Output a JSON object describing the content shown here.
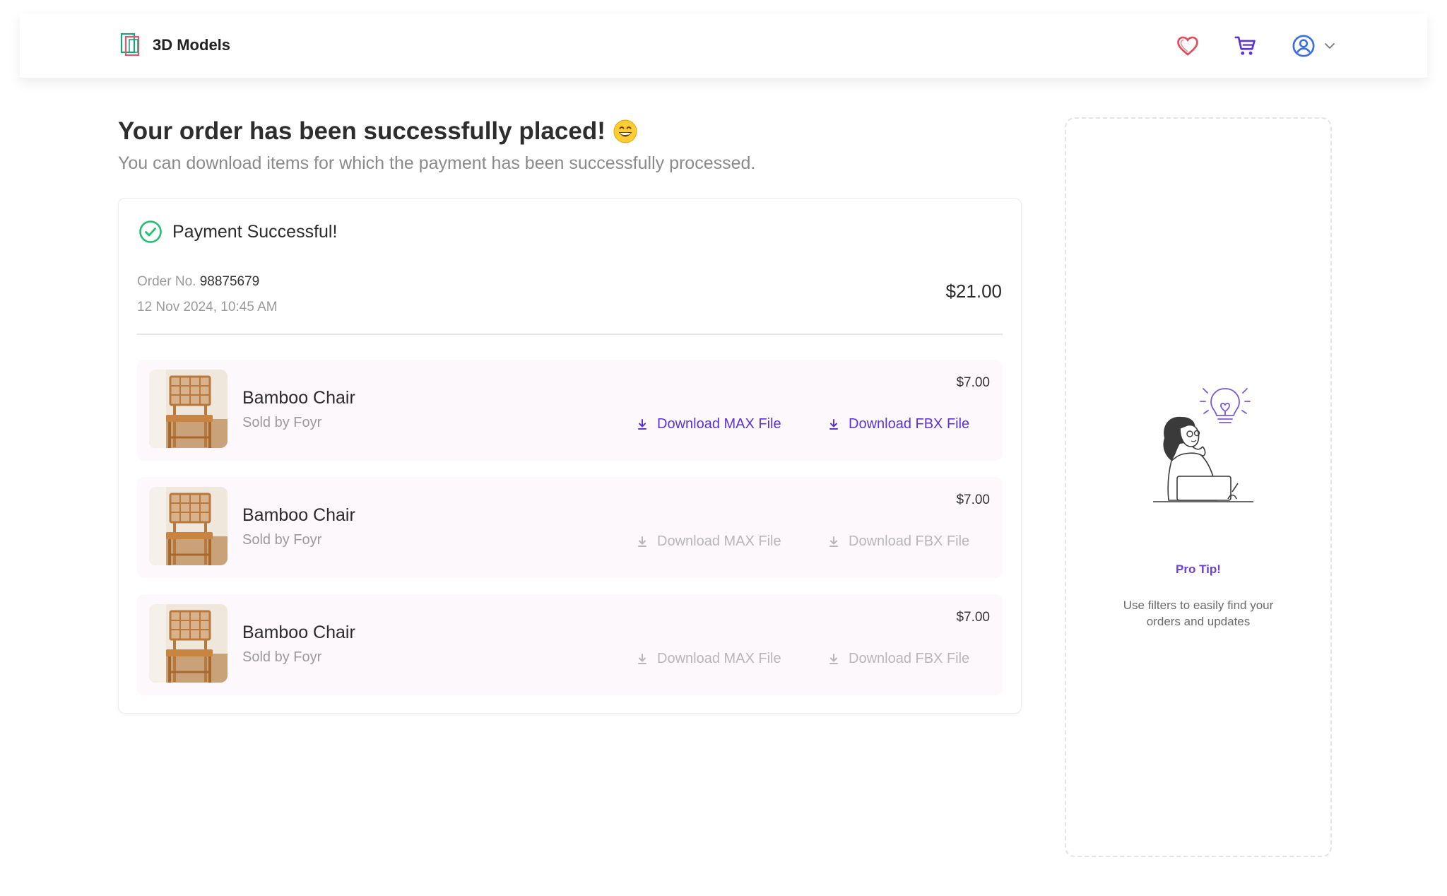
{
  "header": {
    "brand_name": "3D Models",
    "icons": [
      "logo-icon",
      "heart-icon",
      "cart-icon",
      "user-icon",
      "chevron-down-icon"
    ]
  },
  "page": {
    "title": "Your order has been successfully placed!",
    "subtitle": "You can download items for which the payment has been successfully processed."
  },
  "order": {
    "status": "Payment Successful!",
    "order_no_label": "Order No.",
    "order_no": "98875679",
    "date": "12 Nov 2024, 10:45 AM",
    "total": "$21.00",
    "items": [
      {
        "name": "Bamboo Chair",
        "seller": "Sold by Foyr",
        "price": "$7.00",
        "download_max": "Download MAX File",
        "download_fbx": "Download FBX File",
        "downloads_enabled": true
      },
      {
        "name": "Bamboo Chair",
        "seller": "Sold by Foyr",
        "price": "$7.00",
        "download_max": "Download MAX File",
        "download_fbx": "Download FBX File",
        "downloads_enabled": false
      },
      {
        "name": "Bamboo Chair",
        "seller": "Sold by Foyr",
        "price": "$7.00",
        "download_max": "Download MAX File",
        "download_fbx": "Download FBX File",
        "downloads_enabled": false
      }
    ]
  },
  "tip": {
    "title": "Pro Tip!",
    "text": "Use filters to easily find your orders and updates"
  },
  "colors": {
    "accent": "#5b33d6",
    "success": "#1fbf6f",
    "heart": "#e54b5b",
    "disabled": "#b7b7b7",
    "item_bg": "#fdf8fc"
  }
}
